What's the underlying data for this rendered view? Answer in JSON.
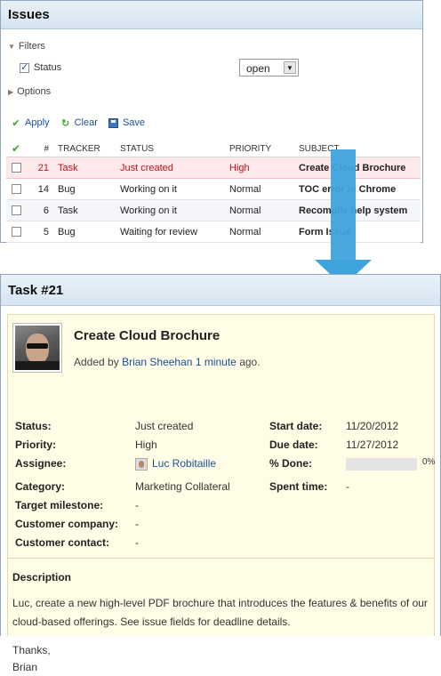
{
  "issues": {
    "title": "Issues",
    "filters_label": "Filters",
    "status_filter_label": "Status",
    "status_filter_value": "open",
    "options_label": "Options",
    "actions": {
      "apply": "Apply",
      "clear": "Clear",
      "save": "Save"
    },
    "columns": [
      "#",
      "TRACKER",
      "STATUS",
      "PRIORITY",
      "SUBJECT"
    ],
    "rows": [
      {
        "id": "21",
        "tracker": "Task",
        "status": "Just created",
        "priority": "High",
        "subject": "Create Cloud Brochure"
      },
      {
        "id": "14",
        "tracker": "Bug",
        "status": "Working on it",
        "priority": "Normal",
        "subject": "TOC error in Chrome"
      },
      {
        "id": "6",
        "tracker": "Task",
        "status": "Working on it",
        "priority": "Normal",
        "subject": "Recompile help system"
      },
      {
        "id": "5",
        "tracker": "Bug",
        "status": "Waiting for review",
        "priority": "Normal",
        "subject": "Form Issue"
      }
    ]
  },
  "task": {
    "header": "Task #21",
    "title": "Create Cloud Brochure",
    "added_prefix": "Added by",
    "author": "Brian Sheehan",
    "added_ago": "1 minute",
    "added_suffix": "ago.",
    "labels": {
      "status": "Status:",
      "priority": "Priority:",
      "assignee": "Assignee:",
      "category": "Category:",
      "target_milestone": "Target milestone:",
      "customer_company": "Customer company:",
      "customer_contact": "Customer contact:",
      "start_date": "Start date:",
      "due_date": "Due date:",
      "done": "% Done:",
      "spent_time": "Spent time:"
    },
    "values": {
      "status": "Just created",
      "priority": "High",
      "assignee": "Luc Robitaille",
      "category": "Marketing Collateral",
      "target_milestone": "-",
      "customer_company": "-",
      "customer_contact": "-",
      "start_date": "11/20/2012",
      "due_date": "11/27/2012",
      "done_percent": "0%",
      "spent_time": "-"
    },
    "description_title": "Description",
    "description_text": "Luc, create a new high-level PDF brochure that introduces the features & benefits of our cloud-based offerings. See issue fields for deadline details.",
    "signoff_1": "Thanks,",
    "signoff_2": "Brian"
  },
  "colors": {
    "accent_link": "#1a4f9c",
    "arrow": "#3fa4dc",
    "highlight_row": "#fde9ea",
    "task_bg": "#fffde6"
  }
}
